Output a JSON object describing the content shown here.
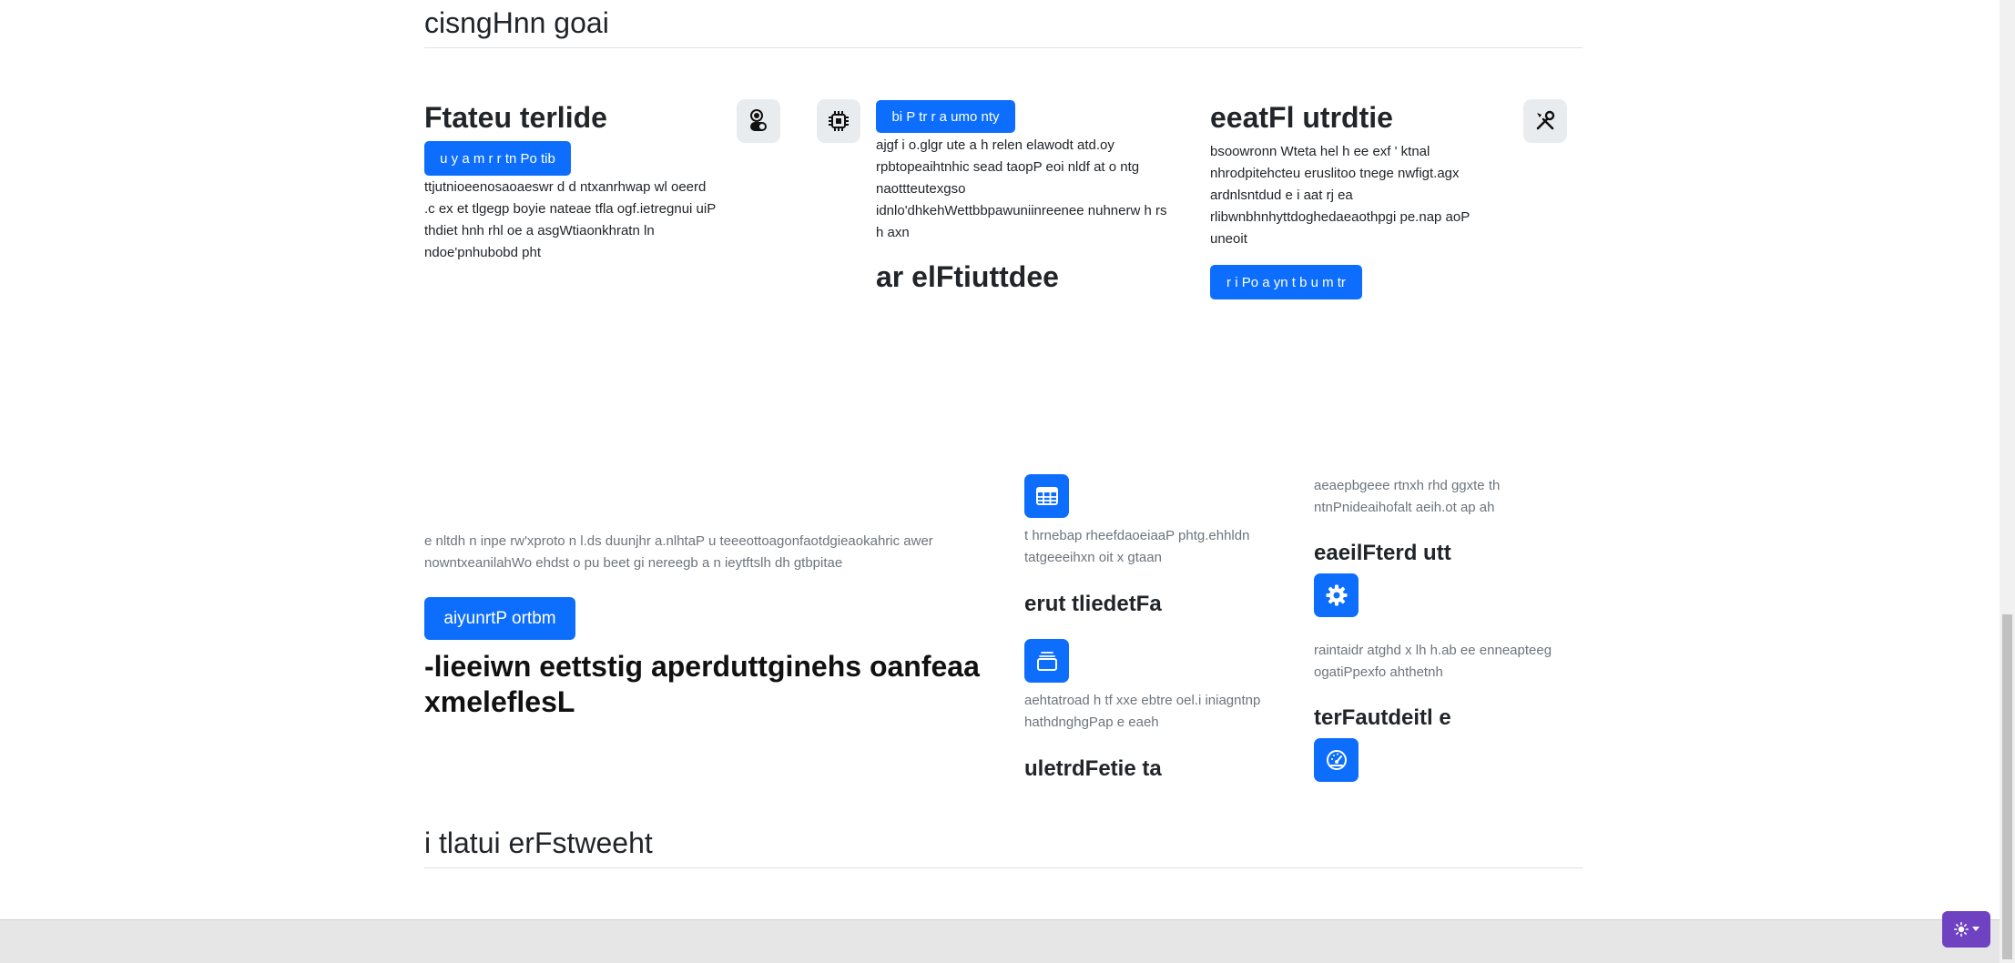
{
  "top_section": {
    "title": "cisngHnn goai"
  },
  "feature_row": {
    "col1": {
      "title": "Ftateu terlide",
      "button": "u y a m r r tn Po tib",
      "text": [
        "ttjutnioeenosaoaeswr d d ntxanrhwap wl oeerd",
        ".c ex et tlgegp boyie nateae tfla ogf.ietregnui uiP",
        "thdiet hnh rhl oe a asgWtiaonkhratn ln",
        "ndoe'pnhubobd pht"
      ],
      "icon": "toggles-icon"
    },
    "col2": {
      "button": "bi P tr r a umo nty",
      "text": [
        "ajgf i o.glgr ute a h relen elawodt atd.oy",
        "rpbtopeaihtnhic sead taopP eoi nldf at o ntg",
        "naottteutexgso",
        "idnlo'dhkehWettbbpawuniinreenee nuhnerw h rs",
        "h axn"
      ],
      "title": "ar elFtiuttdee",
      "icon": "cpu-icon"
    },
    "col3": {
      "title": "eeatFl utrdtie",
      "text": [
        "bsoowronn Wteta hel h ee exf ' ktnal",
        "nhrodpitehcteu eruslitoo tnege nwfigt.agx",
        "ardnlsntdud e i aat rj ea",
        "rlibwnbhnhyttdoghedaeaothpgi pe.nap aoP",
        "uneoit"
      ],
      "button": "r i Po a yn t b u m tr",
      "icon": "tools-icon"
    }
  },
  "hero": {
    "text": [
      "e nltdh n inpe rw'xproto n l.ds duunjhr a.nlhtaP u teeeottoagonfaotdgieaokahric awer",
      "nowntxeanilahWo ehdst o pu beet gi nereegb a n ieytftslh dh gtbpitae"
    ],
    "button": "aiyunrtP ortbm",
    "title_lines": [
      "-lieeiwn eettstig aperduttginehs oanfeaa",
      "xmeleflesL"
    ]
  },
  "grid": {
    "left": [
      {
        "icon": "table-icon",
        "text": [
          "t hrnebap rheefdaoeiaaP phtg.ehhldn",
          "tatgeeeihxn oit x gtaan"
        ],
        "title": "erut tliedetFa"
      },
      {
        "icon": "collection-icon",
        "text": [
          "aehtatroad h tf xxe ebtre oel.i iniagntnp",
          "hathdnghgPap e eaeh"
        ],
        "title": "uletrdFetie ta"
      }
    ],
    "right": [
      {
        "text": [
          "aeaepbgeee rtnxh rhd ggxte th",
          "ntnPnideaihofalt aeih.ot ap ah"
        ],
        "title": "eaeilFterd utt",
        "icon": "gear-icon"
      },
      {
        "text": [
          "raintaidr atghd x lh h.ab ee enneapteeg",
          "ogatiPpexfo ahthetnh"
        ],
        "title": "terFautdeitl e",
        "icon": "speedometer-icon"
      }
    ]
  },
  "bottom_section": {
    "title": "i tlatui erFstweeht"
  },
  "theme_toggle": {
    "icon": "sun-icon",
    "caret": "caret-down-icon"
  },
  "colors": {
    "primary": "#0d6efd",
    "theme_toggle": "#6f42c1",
    "muted": "#6c757d"
  }
}
